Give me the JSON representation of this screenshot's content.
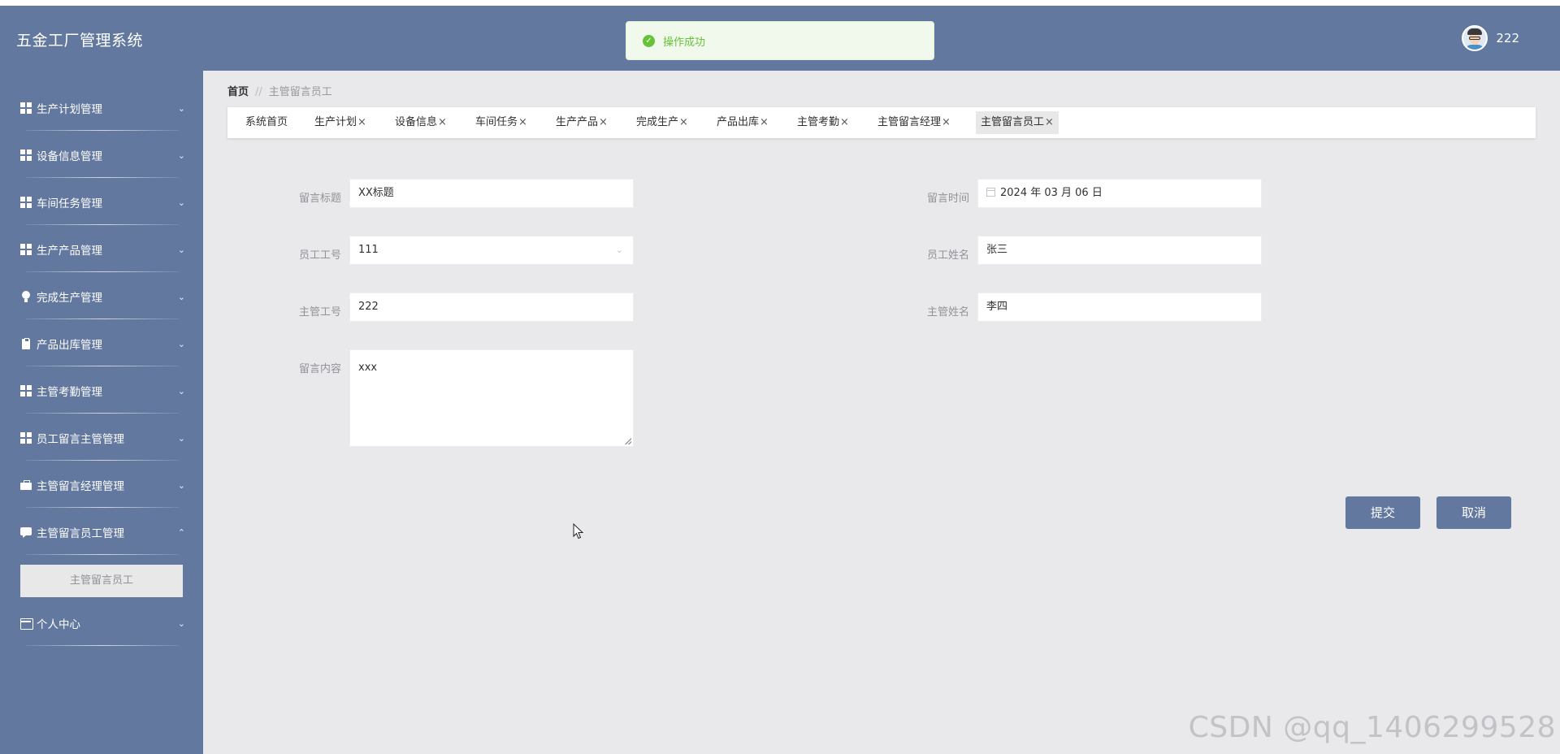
{
  "app": {
    "title": "五金工厂管理系统"
  },
  "user": {
    "name": "222"
  },
  "toast": {
    "message": "操作成功"
  },
  "sidebar": {
    "items": [
      {
        "label": "生产计划管理",
        "icon": "grid-icon",
        "chevron": "⌄"
      },
      {
        "label": "设备信息管理",
        "icon": "grid-icon",
        "chevron": "⌄"
      },
      {
        "label": "车间任务管理",
        "icon": "grid-icon",
        "chevron": "⌄"
      },
      {
        "label": "生产产品管理",
        "icon": "grid-icon",
        "chevron": "⌄"
      },
      {
        "label": "完成生产管理",
        "icon": "bulb-icon",
        "chevron": "⌄"
      },
      {
        "label": "产品出库管理",
        "icon": "clipboard-icon",
        "chevron": "⌄"
      },
      {
        "label": "主管考勤管理",
        "icon": "grid-icon",
        "chevron": "⌄"
      },
      {
        "label": "员工留言主管管理",
        "icon": "grid-icon",
        "chevron": "⌄"
      },
      {
        "label": "主管留言经理管理",
        "icon": "briefcase-icon",
        "chevron": "⌄"
      },
      {
        "label": "主管留言员工管理",
        "icon": "chat-icon",
        "chevron": "⌃"
      },
      {
        "label": "个人中心",
        "icon": "card-icon",
        "chevron": "⌄"
      }
    ],
    "submenu": {
      "label": "主管留言员工"
    }
  },
  "breadcrumb": {
    "home": "首页",
    "separator": "//",
    "current": "主管留言员工"
  },
  "tabs": [
    {
      "label": "系统首页",
      "close": ""
    },
    {
      "label": "生产计划",
      "close": "×"
    },
    {
      "label": "设备信息",
      "close": "×"
    },
    {
      "label": "车间任务",
      "close": "×"
    },
    {
      "label": "生产产品",
      "close": "×"
    },
    {
      "label": "完成生产",
      "close": "×"
    },
    {
      "label": "产品出库",
      "close": "×"
    },
    {
      "label": "主管考勤",
      "close": "×"
    },
    {
      "label": "主管留言经理",
      "close": "×"
    },
    {
      "label": "主管留言员工",
      "close": "×"
    }
  ],
  "form": {
    "title": {
      "label": "留言标题",
      "value": "XX标题"
    },
    "time": {
      "label": "留言时间",
      "value": "2024 年 03 月 06 日"
    },
    "employee_id": {
      "label": "员工工号",
      "value": "111"
    },
    "employee_name": {
      "label": "员工姓名",
      "value": "张三"
    },
    "manager_id": {
      "label": "主管工号",
      "value": "222"
    },
    "manager_name": {
      "label": "主管姓名",
      "value": "李四"
    },
    "content": {
      "label": "留言内容",
      "value": "xxx"
    }
  },
  "buttons": {
    "submit": "提交",
    "cancel": "取消"
  },
  "watermark": "CSDN @qq_1406299528",
  "colors": {
    "primary": "#62789e",
    "success": "#67c23a",
    "background": "#e9e9eb"
  }
}
